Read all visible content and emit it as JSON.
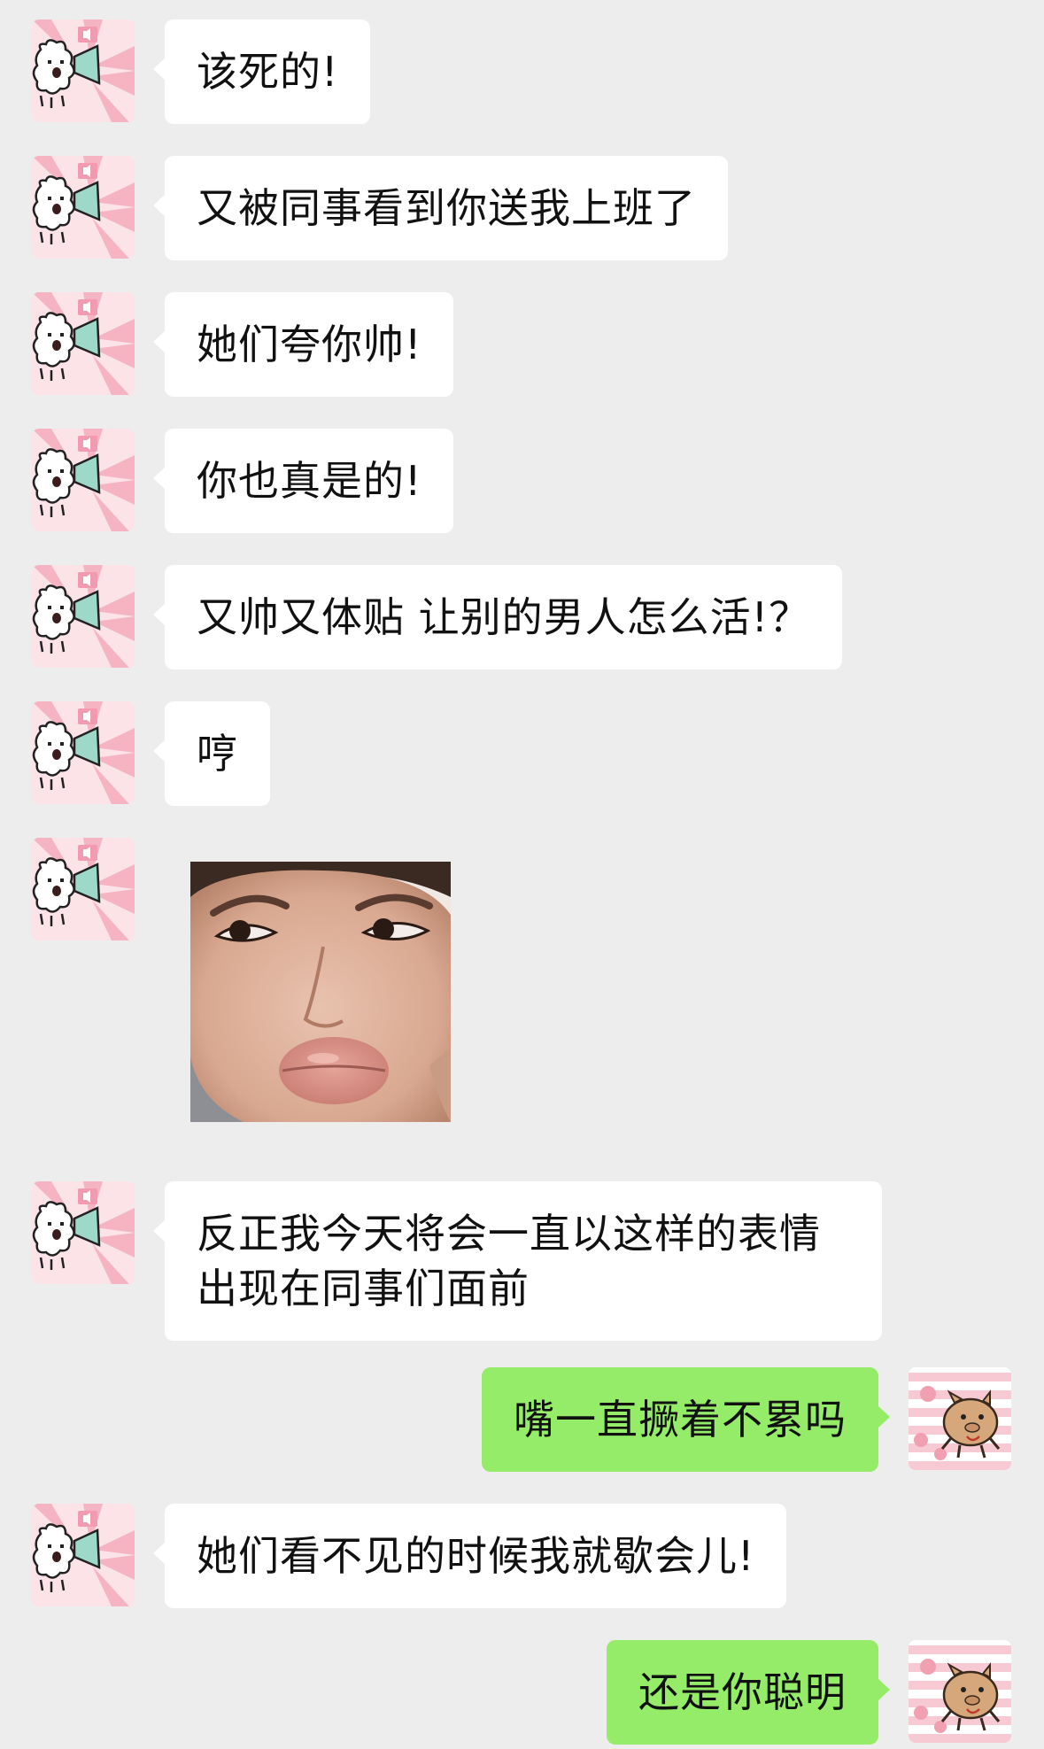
{
  "conversation": {
    "messages": [
      {
        "from": "contact",
        "type": "text",
        "text": "该死的!"
      },
      {
        "from": "contact",
        "type": "text",
        "text": "又被同事看到你送我上班了"
      },
      {
        "from": "contact",
        "type": "text",
        "text": "她们夸你帅!"
      },
      {
        "from": "contact",
        "type": "text",
        "text": "你也真是的!"
      },
      {
        "from": "contact",
        "type": "text",
        "text": "又帅又体贴 让别的男人怎么活!？"
      },
      {
        "from": "contact",
        "type": "text",
        "text": "哼"
      },
      {
        "from": "contact",
        "type": "image",
        "image": "pouting-face-photo"
      },
      {
        "from": "contact",
        "type": "text",
        "text": "反正我今天将会一直以这样的表情出现在同事们面前"
      },
      {
        "from": "me",
        "type": "text",
        "text": "嘴一直撅着不累吗"
      },
      {
        "from": "contact",
        "type": "text",
        "text": "她们看不见的时候我就歇会儿!"
      },
      {
        "from": "me",
        "type": "text",
        "text": "还是你聪明"
      }
    ]
  },
  "avatars": {
    "contact": "white-cartoon-dog-megaphone-avatar",
    "me": "brown-cartoon-pig-avatar"
  },
  "colors": {
    "background": "#ededed",
    "incoming_bubble": "#ffffff",
    "outgoing_bubble": "#95ec69",
    "text": "#111111",
    "avatar_pink": "#f7c9d3"
  }
}
